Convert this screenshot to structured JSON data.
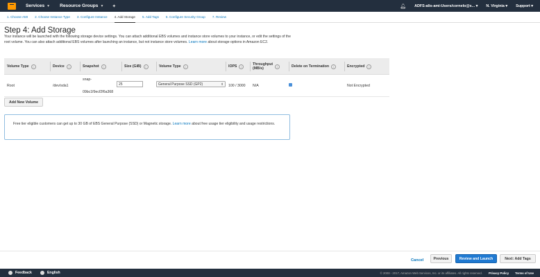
{
  "nav": {
    "services": "Services",
    "resource_groups": "Resource Groups",
    "account": "ADFS-alis-ami-Users/cornelo@s...",
    "region": "N. Virginia",
    "support": "Support"
  },
  "tabs": [
    {
      "label": "1. Choose AMI"
    },
    {
      "label": "2. Choose Instance Type"
    },
    {
      "label": "3. Configure Instance"
    },
    {
      "label": "4. Add Storage"
    },
    {
      "label": "5. Add Tags"
    },
    {
      "label": "6. Configure Security Group"
    },
    {
      "label": "7. Review"
    }
  ],
  "page": {
    "title": "Step 4: Add Storage",
    "desc": "Your instance will be launched with the following storage device settings. You can attach additional EBS volumes and instance store volumes to your instance, or edit the settings of the root volume. You can also attach additional EBS volumes after launching an instance, but not instance store volumes.",
    "learn_more": "Learn more",
    "desc_tail": "about storage options in Amazon EC2."
  },
  "table": {
    "headers": {
      "volume_type": "Volume Type",
      "device": "Device",
      "snapshot": "Snapshot",
      "size": "Size (GiB)",
      "vol_type": "Volume Type",
      "iops": "IOPS",
      "throughput_1": "Throughput",
      "throughput_2": "(MB/s)",
      "delete": "Delete on Termination",
      "encrypted": "Encrypted"
    },
    "row": {
      "volume_type": "Root",
      "device": "/dev/sda1",
      "snapshot_1": "snap-",
      "snapshot_2": "09bc1f9ecf2f6a368",
      "size": "25",
      "vol_type": "General Purpose SSD (GP2)",
      "iops": "100 / 3000",
      "throughput": "N/A",
      "delete_checked": true,
      "encrypted": "Not Encrypted"
    }
  },
  "add_volume": "Add New Volume",
  "alert": {
    "text": "Free tier eligible customers can get up to 30 GB of EBS General Purpose (SSD) or Magnetic storage.",
    "learn_more": "Learn more",
    "tail": "about free usage tier eligibility and usage restrictions."
  },
  "actions": {
    "cancel": "Cancel",
    "previous": "Previous",
    "review": "Review and Launch",
    "next": "Next: Add Tags"
  },
  "footer": {
    "feedback": "Feedback",
    "language": "English",
    "copyright": "© 2008 - 2017, Amazon Web Services, Inc. or its affiliates. All rights reserved.",
    "privacy": "Privacy Policy",
    "terms": "Terms of Use"
  },
  "colors": {
    "nav_bg": "#232f3e",
    "accent": "#0073bb",
    "primary_button": "#1f79d1",
    "logo": "#ff9900"
  }
}
